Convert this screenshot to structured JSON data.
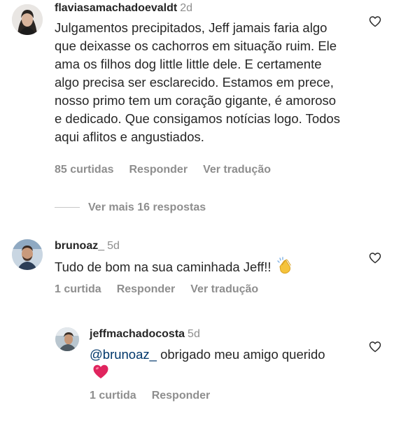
{
  "comments": [
    {
      "username": "flaviasamachadoevaldt",
      "time": "2d",
      "text": "Julgamentos precipitados, Jeff jamais faria algo que deixasse os cachorros em situação ruim. Ele ama os filhos dog little little dele. E certamente algo precisa ser esclarecido. Estamos em prece, nosso primo tem um coração gigante, é amoroso e dedicado. Que consigamos notícias logo. Todos aqui aflitos e angustiados.",
      "likes": "85 curtidas",
      "reply": "Responder",
      "translate": "Ver tradução"
    },
    {
      "username": "brunoaz_",
      "time": "5d",
      "text": "Tudo de bom na sua caminhada Jeff!!",
      "likes": "1 curtida",
      "reply": "Responder",
      "translate": "Ver tradução"
    }
  ],
  "view_more": "Ver mais 16 respostas",
  "reply": {
    "username": "jeffmachadocosta",
    "time": "5d",
    "mention": "@brunoaz_",
    "text": "obrigado meu amigo querido",
    "likes": "1 curtida",
    "reply": "Responder"
  },
  "icons": {
    "like": "heart-outline-icon",
    "red_heart": "red-heart-emoji",
    "clap": "clapping-hands-emoji"
  },
  "colors": {
    "text": "#262626",
    "secondary": "#8e8e8e",
    "mention": "#00376b",
    "heart_red": "#e0245e"
  }
}
